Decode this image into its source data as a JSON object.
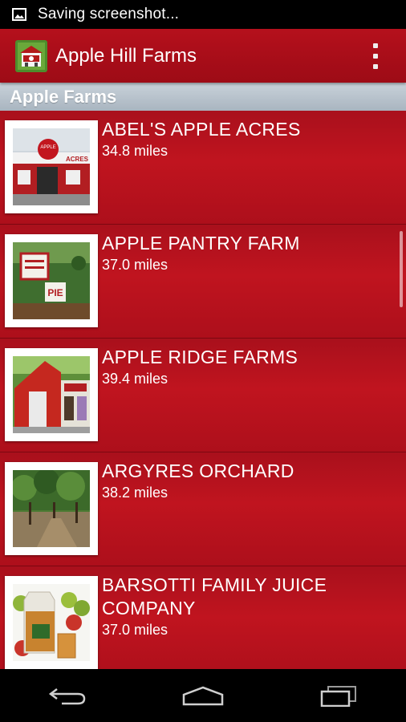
{
  "status_bar": {
    "notification_text": "Saving screenshot..."
  },
  "app_bar": {
    "title": "Apple Hill Farms"
  },
  "section": {
    "title": "Apple Farms"
  },
  "farms": [
    {
      "name": "ABEL'S APPLE ACRES",
      "distance": "34.8 miles",
      "thumbnail": "abels-apple-acres-photo",
      "sign_text": "APPLE",
      "sign_text2": "ACRES"
    },
    {
      "name": "APPLE PANTRY FARM",
      "distance": "37.0 miles",
      "thumbnail": "apple-pantry-farm-photo",
      "sign_text": "PIE"
    },
    {
      "name": "APPLE RIDGE FARMS",
      "distance": "39.4 miles",
      "thumbnail": "apple-ridge-farms-photo"
    },
    {
      "name": "ARGYRES ORCHARD",
      "distance": "38.2 miles",
      "thumbnail": "argyres-orchard-photo"
    },
    {
      "name": "BARSOTTI FAMILY JUICE COMPANY",
      "distance": "37.0 miles",
      "thumbnail": "barsotti-juice-photo"
    }
  ],
  "colors": {
    "accent": "#b5101c",
    "list_bg": "#c0141f",
    "section_bg": "#b9c4ce"
  },
  "icons": {
    "status": "image-icon",
    "menu": "overflow-menu-icon",
    "back": "back-icon",
    "home": "home-icon",
    "recents": "recents-icon"
  }
}
